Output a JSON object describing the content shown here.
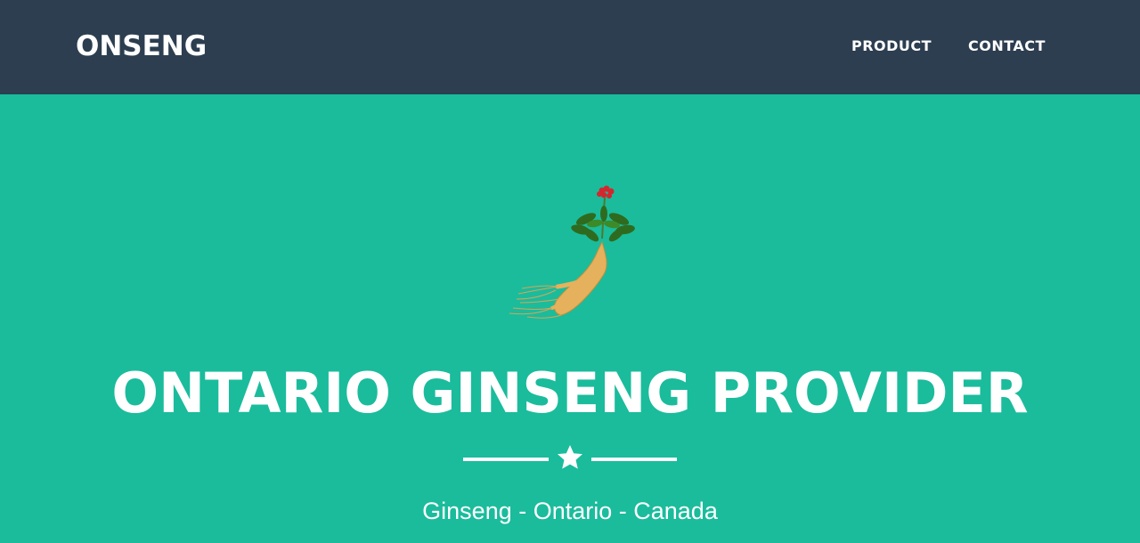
{
  "navbar": {
    "brand": "ONSENG",
    "links": [
      {
        "label": "PRODUCT"
      },
      {
        "label": "CONTACT"
      }
    ]
  },
  "masthead": {
    "image_icon": "ginseng-root-icon",
    "heading": "ONTARIO GINSENG PROVIDER",
    "divider_icon": "star-icon",
    "subheading": "Ginseng - Ontario - Canada"
  },
  "colors": {
    "navbar_bg": "#2c3e50",
    "masthead_bg": "#1abc9c",
    "text": "#ffffff"
  }
}
